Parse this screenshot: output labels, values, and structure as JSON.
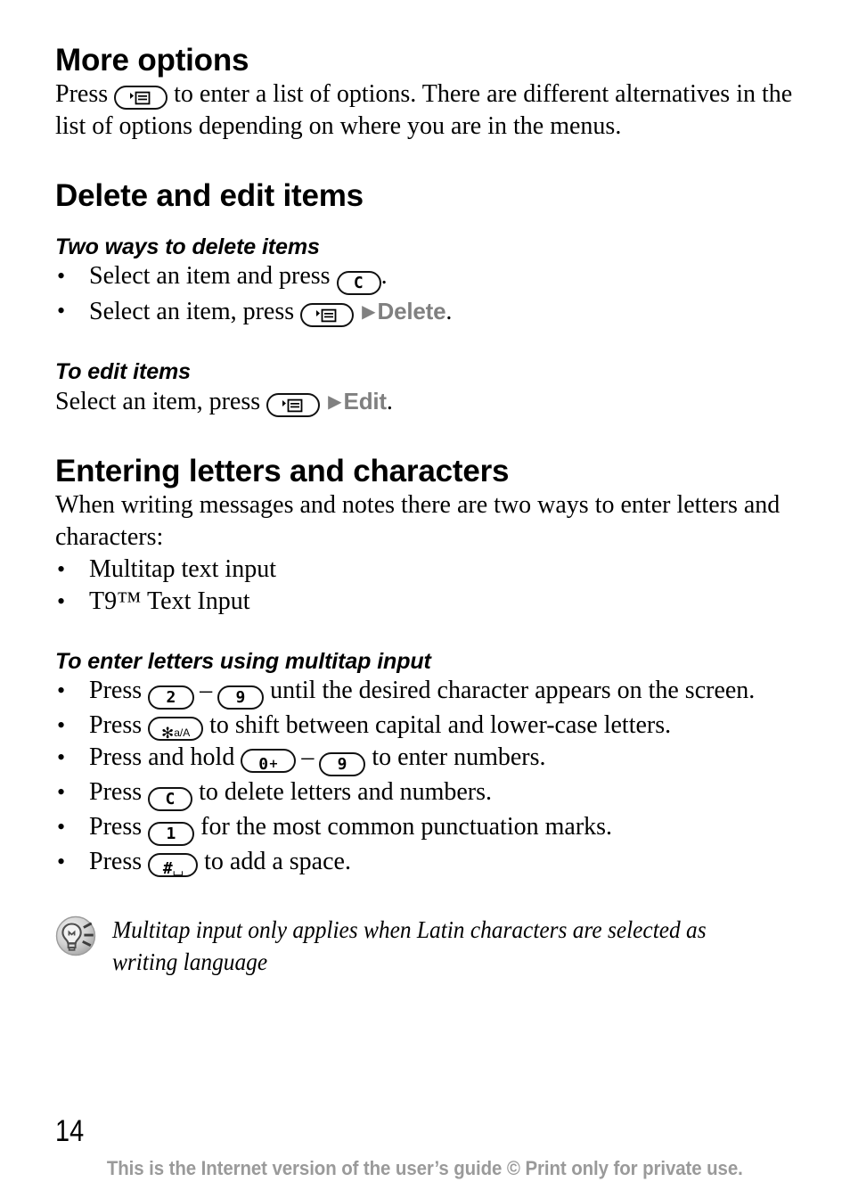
{
  "document": {
    "page_number": "14",
    "footer_note": "This is the Internet version of the user’s guide © Print only for private use.",
    "colors": {
      "text": "#000000",
      "menu_keyword": "#808080",
      "footer": "#9a9a9a",
      "key_outline": "#111111"
    }
  },
  "sections": {
    "more_options": {
      "heading": "More options",
      "body_before_key": "Press",
      "key": "options-key",
      "body_after_key": "to enter a list of options. There are different alternatives in the list of options depending on where you are in the menus."
    },
    "delete_and_edit": {
      "heading": "Delete and edit items",
      "two_ways": {
        "subheading": "Two ways to delete items",
        "bullets": [
          {
            "before_key": "Select an item and press",
            "key": "clear-key",
            "key_label": "C",
            "after_key": "."
          },
          {
            "before_key": "Select an item, press",
            "key": "options-key",
            "arrow": "▶",
            "menu_word": "Delete",
            "after_key": "."
          }
        ]
      },
      "to_edit": {
        "subheading": "To edit items",
        "before_key": "Select an item, press",
        "key": "options-key",
        "arrow": "▶",
        "menu_word": "Edit",
        "after_key": "."
      }
    },
    "entering_letters": {
      "heading": "Entering letters and characters",
      "intro": "When writing messages and notes there are two ways to enter letters and characters:",
      "bullets": [
        "Multitap text input",
        "T9™ Text Input"
      ],
      "multitap": {
        "subheading": "To enter letters using multitap input",
        "bullets": [
          {
            "before_key": "Press",
            "key1_label": "2",
            "separator": "–",
            "key2_label": "9",
            "after_key": "until the desired character appears on the screen."
          },
          {
            "before_key": "Press",
            "key1_label": "✻ a/A",
            "key1_main": "✻",
            "key1_sub": "a/A",
            "after_key": "to shift between capital and lower-case letters."
          },
          {
            "before_key": "Press and hold",
            "key1_main": "0",
            "key1_sub": "+",
            "separator": "–",
            "key2_label": "9",
            "after_key": "to enter numbers."
          },
          {
            "before_key": "Press",
            "key1_label": "C",
            "after_key": "to delete letters and numbers."
          },
          {
            "before_key": "Press",
            "key1_label": "1",
            "after_key": "for the most common punctuation marks."
          },
          {
            "before_key": "Press",
            "key1_main": "#",
            "key1_sub": "⌴",
            "after_key": "to add a space."
          }
        ],
        "note": {
          "icon": "lightbulb-tip-icon",
          "text": "Multitap input only applies when Latin characters are selected as writing language"
        }
      }
    }
  }
}
